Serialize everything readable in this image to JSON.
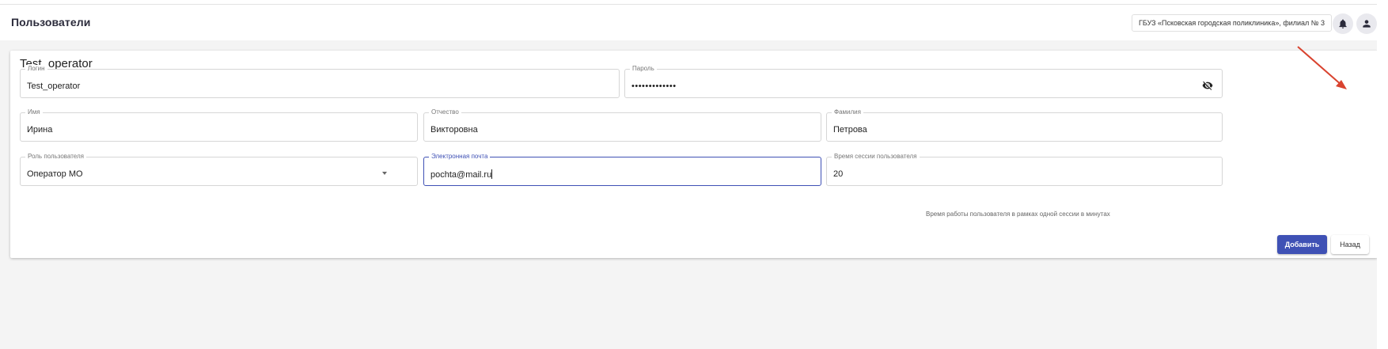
{
  "header": {
    "title": "Пользователи",
    "organization": "ГБУЗ «Псковская городская поликлиника», филиал № 3",
    "icons": [
      "bell-icon",
      "account-icon"
    ]
  },
  "card": {
    "title": "Test_operator"
  },
  "form": {
    "login": {
      "label": "Логин",
      "value": "Test_operator"
    },
    "password": {
      "label": "Пароль",
      "value": "•••••••••••••"
    },
    "first_name": {
      "label": "Имя",
      "value": "Ирина"
    },
    "patronymic": {
      "label": "Отчество",
      "value": "Викторовна"
    },
    "last_name": {
      "label": "Фамилия",
      "value": "Петрова"
    },
    "role": {
      "label": "Роль пользователя",
      "value": "Оператор МО"
    },
    "email": {
      "label": "Электронная почта",
      "value": "pochta@mail.ru"
    },
    "session_time": {
      "label": "Время сессии пользователя",
      "value": "20",
      "helper": "Время работы пользователя в рамках одной сессии в минутах"
    }
  },
  "actions": {
    "add_label": "Добавить",
    "back_label": "Назад"
  },
  "colors": {
    "primary": "#3f51b5",
    "annotation_arrow": "#d9432f",
    "background": "#f4f4f4"
  }
}
